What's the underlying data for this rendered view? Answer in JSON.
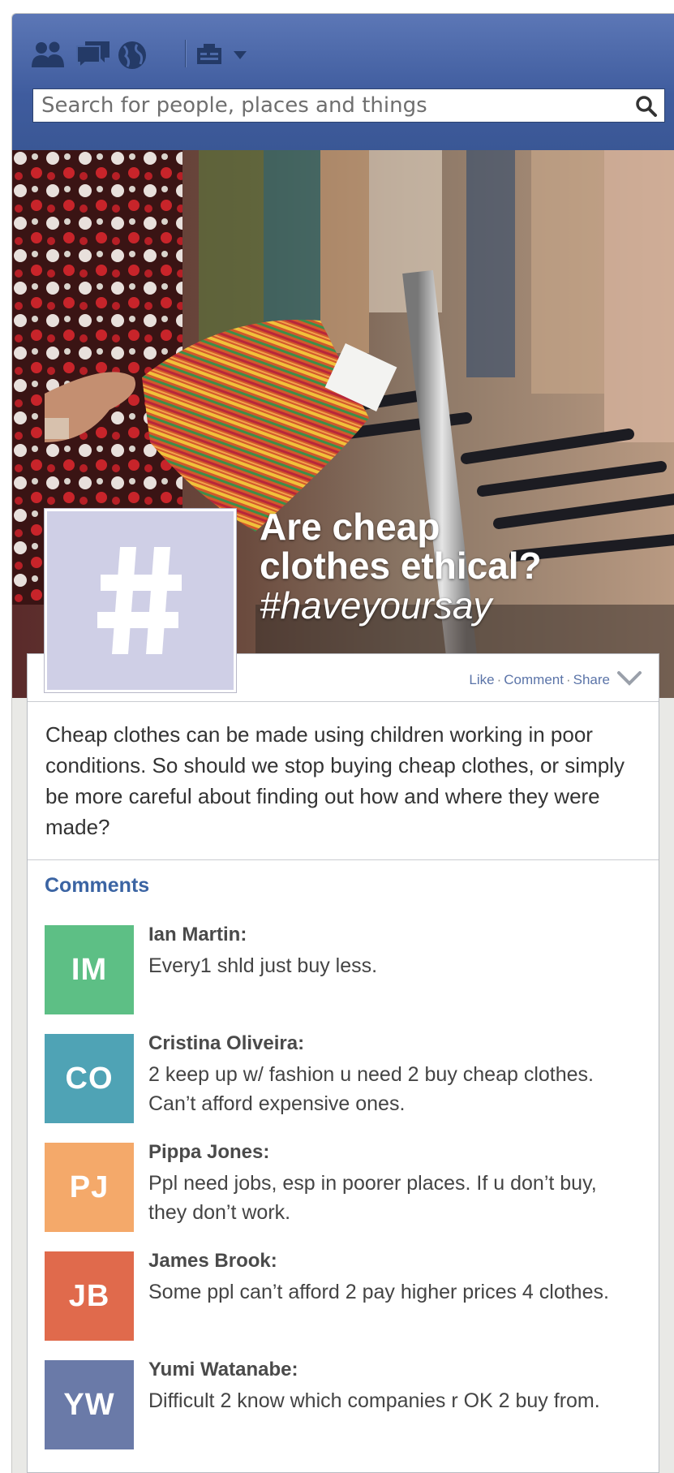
{
  "search": {
    "placeholder": "Search for people, places and things"
  },
  "post": {
    "title": "Are cheap clothes ethical?",
    "hashtag": "#haveyoursay",
    "actions": {
      "like": "Like",
      "comment": "Comment",
      "share": "Share"
    },
    "body": "Cheap clothes can be made using children working in poor conditions. So should we stop buying cheap clothes, or simply be more careful about finding out how and where they were made?"
  },
  "comments": {
    "heading": "Comments",
    "items": [
      {
        "initials": "IM",
        "name": "Ian Martin:",
        "text": "Every1 shld just buy less.",
        "color": "#5dbf85"
      },
      {
        "initials": "CO",
        "name": "Cristina Oliveira:",
        "text": "2 keep up w/ fashion u need 2 buy cheap clothes. Can’t afford expensive ones.",
        "color": "#4fa3b5"
      },
      {
        "initials": "PJ",
        "name": "Pippa Jones:",
        "text": "Ppl need jobs, esp in poorer places. If u don’t buy, they don’t work.",
        "color": "#f4a96a"
      },
      {
        "initials": "JB",
        "name": "James Brook:",
        "text": "Some ppl can’t afford 2 pay higher prices 4 clothes.",
        "color": "#e06a4c"
      },
      {
        "initials": "YW",
        "name": "Yumi Watanabe:",
        "text": "Difficult 2 know which companies r OK 2 buy from.",
        "color": "#6a7aa8"
      }
    ]
  },
  "colors": {
    "header_blue": "#3b5998",
    "link_blue": "#3b64a3",
    "profile_lilac": "#cfcfe6"
  },
  "icons": [
    "friends-icon",
    "messages-icon",
    "globe-icon",
    "account-icon",
    "dropdown-arrow-icon",
    "search-icon",
    "hashtag-icon",
    "chevron-down-icon"
  ]
}
